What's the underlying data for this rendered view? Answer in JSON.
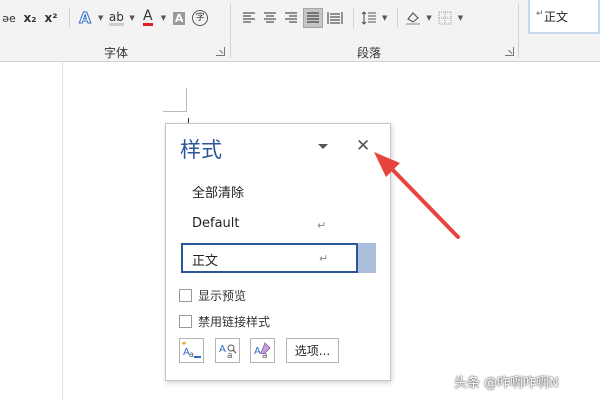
{
  "ribbon": {
    "font_group_label": "字体",
    "paragraph_group_label": "段落",
    "font_buttons": {
      "abc_label": "ǝ",
      "subscript_label": "x₂",
      "superscript_label": "x²",
      "text_effects_label": "A",
      "highlight_label": "ab",
      "font_color_label": "A",
      "char_shading_label": "A",
      "enclose_label": "字"
    },
    "style_gallery_item": "正文",
    "style_gallery_mark": "↵"
  },
  "styles_pane": {
    "title": "样式",
    "close_glyph": "✕",
    "items": [
      {
        "label": "全部清除"
      },
      {
        "label": "Default",
        "mark": "↵"
      },
      {
        "label": "正文",
        "mark": "↵",
        "selected": true
      }
    ],
    "checkboxes": [
      {
        "label": "显示预览",
        "checked": false
      },
      {
        "label": "禁用链接样式",
        "checked": false
      }
    ],
    "options_button": "选项..."
  },
  "watermark": "头条 @咋啊咋啊N",
  "colors": {
    "accent": "#2b579a",
    "selected_tab": "#a9bfdb",
    "arrow": "#e8443f",
    "font_color_bar": "#e02020"
  }
}
